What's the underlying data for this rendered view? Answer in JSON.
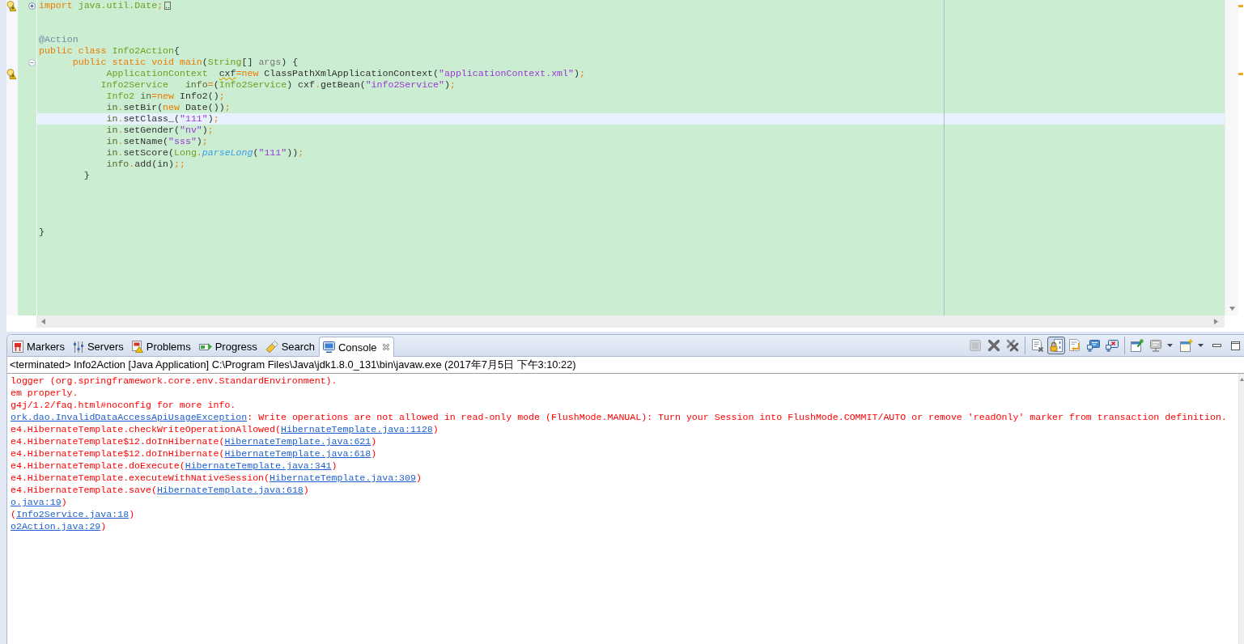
{
  "editor": {
    "lines": [
      {
        "current": false,
        "warning": true,
        "folded": true,
        "tokens": [
          {
            "kind": "keyword",
            "text": "import"
          },
          {
            "kind": "type",
            "text": " java.util.Date"
          },
          {
            "kind": "punct",
            "text": ";"
          }
        ]
      },
      {
        "current": false
      },
      {
        "current": false
      },
      {
        "current": false,
        "tokens": [
          {
            "kind": "annotation",
            "text": "@Action"
          }
        ]
      },
      {
        "current": false,
        "tokens": [
          {
            "kind": "keyword",
            "text": "public class "
          },
          {
            "kind": "type",
            "text": "Info2Action"
          },
          {
            "kind": "plain",
            "text": "{"
          }
        ]
      },
      {
        "current": false,
        "folded": false,
        "tokens": [
          {
            "kind": "keyword",
            "text": "      public static void main"
          },
          {
            "kind": "plain",
            "text": "("
          },
          {
            "kind": "type",
            "text": "String"
          },
          {
            "kind": "plain",
            "text": "[] "
          },
          {
            "kind": "param",
            "text": "args"
          },
          {
            "kind": "plain",
            "text": ") {"
          }
        ]
      },
      {
        "current": false,
        "warning": true,
        "tokens": [
          {
            "kind": "type",
            "text": "            ApplicationContext  "
          },
          {
            "kind": "flagged",
            "text": "cxf"
          },
          {
            "kind": "punct",
            "text": "="
          },
          {
            "kind": "keyword",
            "text": "new"
          },
          {
            "kind": "plain",
            "text": " ClassPathXmlApplicationContext("
          },
          {
            "kind": "string",
            "text": "\"applicationContext.xml\""
          },
          {
            "kind": "plain",
            "text": ")"
          },
          {
            "kind": "punct",
            "text": ";"
          }
        ]
      },
      {
        "current": false,
        "tokens": [
          {
            "kind": "type",
            "text": "           Info2Service   "
          },
          {
            "kind": "local",
            "text": "info"
          },
          {
            "kind": "punct",
            "text": "="
          },
          {
            "kind": "plain",
            "text": "("
          },
          {
            "kind": "type",
            "text": "Info2Service"
          },
          {
            "kind": "plain",
            "text": ") cxf"
          },
          {
            "kind": "punct",
            "text": "."
          },
          {
            "kind": "plain",
            "text": "getBean("
          },
          {
            "kind": "string",
            "text": "\"info2Service\""
          },
          {
            "kind": "plain",
            "text": ")"
          },
          {
            "kind": "punct",
            "text": ";"
          }
        ]
      },
      {
        "current": false,
        "tokens": [
          {
            "kind": "type",
            "text": "            Info2 "
          },
          {
            "kind": "local",
            "text": "in"
          },
          {
            "kind": "punct",
            "text": "="
          },
          {
            "kind": "keyword",
            "text": "new"
          },
          {
            "kind": "plain",
            "text": " Info2()"
          },
          {
            "kind": "punct",
            "text": ";"
          }
        ]
      },
      {
        "current": false,
        "tokens": [
          {
            "kind": "local",
            "text": "            in"
          },
          {
            "kind": "punct",
            "text": "."
          },
          {
            "kind": "plain",
            "text": "setBir("
          },
          {
            "kind": "keyword",
            "text": "new"
          },
          {
            "kind": "plain",
            "text": " Date())"
          },
          {
            "kind": "punct",
            "text": ";"
          }
        ]
      },
      {
        "current": true,
        "tokens": [
          {
            "kind": "local",
            "text": "            in"
          },
          {
            "kind": "punct",
            "text": "."
          },
          {
            "kind": "plain",
            "text": "setClass_("
          },
          {
            "kind": "string",
            "text": "\"111\""
          },
          {
            "kind": "plain",
            "text": ")"
          },
          {
            "kind": "punct",
            "text": ";"
          }
        ]
      },
      {
        "current": false,
        "tokens": [
          {
            "kind": "local",
            "text": "            in"
          },
          {
            "kind": "punct",
            "text": "."
          },
          {
            "kind": "plain",
            "text": "setGender("
          },
          {
            "kind": "string",
            "text": "\"nv\""
          },
          {
            "kind": "plain",
            "text": ")"
          },
          {
            "kind": "punct",
            "text": ";"
          }
        ]
      },
      {
        "current": false,
        "tokens": [
          {
            "kind": "local",
            "text": "            in"
          },
          {
            "kind": "punct",
            "text": "."
          },
          {
            "kind": "plain",
            "text": "setName("
          },
          {
            "kind": "string",
            "text": "\"sss\""
          },
          {
            "kind": "plain",
            "text": ")"
          },
          {
            "kind": "punct",
            "text": ";"
          }
        ]
      },
      {
        "current": false,
        "tokens": [
          {
            "kind": "local",
            "text": "            in"
          },
          {
            "kind": "punct",
            "text": "."
          },
          {
            "kind": "plain",
            "text": "setScore("
          },
          {
            "kind": "type",
            "text": "Long"
          },
          {
            "kind": "punct",
            "text": "."
          },
          {
            "kind": "static",
            "text": "parseLong"
          },
          {
            "kind": "plain",
            "text": "("
          },
          {
            "kind": "string",
            "text": "\"111\""
          },
          {
            "kind": "plain",
            "text": "))"
          },
          {
            "kind": "punct",
            "text": ";"
          }
        ]
      },
      {
        "current": false,
        "tokens": [
          {
            "kind": "local",
            "text": "            info"
          },
          {
            "kind": "punct",
            "text": "."
          },
          {
            "kind": "plain",
            "text": "add(in)"
          },
          {
            "kind": "punct",
            "text": ";;"
          }
        ]
      },
      {
        "current": false,
        "tokens": [
          {
            "kind": "plain",
            "text": "        }"
          }
        ]
      },
      {
        "current": false
      },
      {
        "current": false
      },
      {
        "current": false
      },
      {
        "current": false
      },
      {
        "current": false,
        "tokens": [
          {
            "kind": "plain",
            "text": "}"
          }
        ]
      }
    ]
  },
  "console_view": {
    "tabs": [
      {
        "kind": "markers",
        "label": "Markers",
        "selected": false
      },
      {
        "kind": "servers",
        "label": "Servers",
        "selected": false
      },
      {
        "kind": "problems",
        "label": "Problems",
        "selected": false
      },
      {
        "kind": "progress",
        "label": "Progress",
        "selected": false
      },
      {
        "kind": "search",
        "label": "Search",
        "selected": false
      },
      {
        "kind": "console",
        "label": "Console",
        "selected": true
      }
    ],
    "toolbar": [
      {
        "buttons": [
          {
            "kind": "terminate",
            "disabled": true,
            "pressed": false
          },
          {
            "kind": "remove-launch",
            "disabled": false,
            "pressed": false
          },
          {
            "kind": "remove-all",
            "disabled": false,
            "pressed": false
          }
        ]
      },
      {
        "buttons": [
          {
            "kind": "clear",
            "disabled": false,
            "pressed": false
          },
          {
            "kind": "scroll-lock",
            "disabled": false,
            "pressed": true
          },
          {
            "kind": "word-wrap",
            "disabled": false,
            "pressed": false
          },
          {
            "kind": "show-stdout",
            "disabled": false,
            "pressed": false
          },
          {
            "kind": "show-stderr",
            "disabled": false,
            "pressed": false
          }
        ]
      },
      {
        "buttons": [
          {
            "kind": "pin",
            "disabled": false,
            "pressed": false
          },
          {
            "kind": "display-console",
            "disabled": false,
            "pressed": false
          },
          {
            "kind": "caret",
            "disabled": false,
            "pressed": false
          },
          {
            "kind": "open-console",
            "disabled": false,
            "pressed": false
          },
          {
            "kind": "caret",
            "disabled": false,
            "pressed": false
          }
        ]
      }
    ],
    "view_controls": [
      {
        "kind": "minimize"
      },
      {
        "kind": "maximize"
      }
    ],
    "header": "<terminated> Info2Action [Java Application] C:\\Program Files\\Java\\jdk1.8.0_131\\bin\\javaw.exe (2017年7月5日 下午3:10:22)",
    "lines": [
      {
        "segments": [
          {
            "kind": "error",
            "text": "logger (org.springframework.core.env.StandardEnvironment)."
          }
        ]
      },
      {
        "segments": [
          {
            "kind": "error",
            "text": "em properly."
          }
        ]
      },
      {
        "segments": [
          {
            "kind": "error",
            "text": "g4j/1.2/faq.html#noconfig for more info."
          }
        ]
      },
      {
        "segments": [
          {
            "kind": "link",
            "text": "ork.dao.InvalidDataAccessApiUsageException"
          },
          {
            "kind": "error",
            "text": ": Write operations are not allowed in read-only mode (FlushMode.MANUAL): Turn your Session into FlushMode.COMMIT/AUTO or remove 'readOnly' marker from transaction definition."
          }
        ]
      },
      {
        "segments": [
          {
            "kind": "error",
            "text": "e4.HibernateTemplate.checkWriteOperationAllowed("
          },
          {
            "kind": "link",
            "text": "HibernateTemplate.java:1128"
          },
          {
            "kind": "error",
            "text": ")"
          }
        ]
      },
      {
        "segments": [
          {
            "kind": "error",
            "text": "e4.HibernateTemplate$12.doInHibernate("
          },
          {
            "kind": "link",
            "text": "HibernateTemplate.java:621"
          },
          {
            "kind": "error",
            "text": ")"
          }
        ]
      },
      {
        "segments": [
          {
            "kind": "error",
            "text": "e4.HibernateTemplate$12.doInHibernate("
          },
          {
            "kind": "link",
            "text": "HibernateTemplate.java:618"
          },
          {
            "kind": "error",
            "text": ")"
          }
        ]
      },
      {
        "segments": [
          {
            "kind": "error",
            "text": "e4.HibernateTemplate.doExecute("
          },
          {
            "kind": "link",
            "text": "HibernateTemplate.java:341"
          },
          {
            "kind": "error",
            "text": ")"
          }
        ]
      },
      {
        "segments": [
          {
            "kind": "error",
            "text": "e4.HibernateTemplate.executeWithNativeSession("
          },
          {
            "kind": "link",
            "text": "HibernateTemplate.java:309"
          },
          {
            "kind": "error",
            "text": ")"
          }
        ]
      },
      {
        "segments": [
          {
            "kind": "error",
            "text": "e4.HibernateTemplate.save("
          },
          {
            "kind": "link",
            "text": "HibernateTemplate.java:618"
          },
          {
            "kind": "error",
            "text": ")"
          }
        ]
      },
      {
        "segments": [
          {
            "kind": "link",
            "text": "o.java:19"
          },
          {
            "kind": "error",
            "text": ")"
          }
        ]
      },
      {
        "segments": [
          {
            "kind": "error",
            "text": "("
          },
          {
            "kind": "link",
            "text": "Info2Service.java:18"
          },
          {
            "kind": "error",
            "text": ")"
          }
        ]
      },
      {
        "segments": [
          {
            "kind": "link",
            "text": "o2Action.java:29"
          },
          {
            "kind": "error",
            "text": ")"
          }
        ]
      }
    ]
  }
}
